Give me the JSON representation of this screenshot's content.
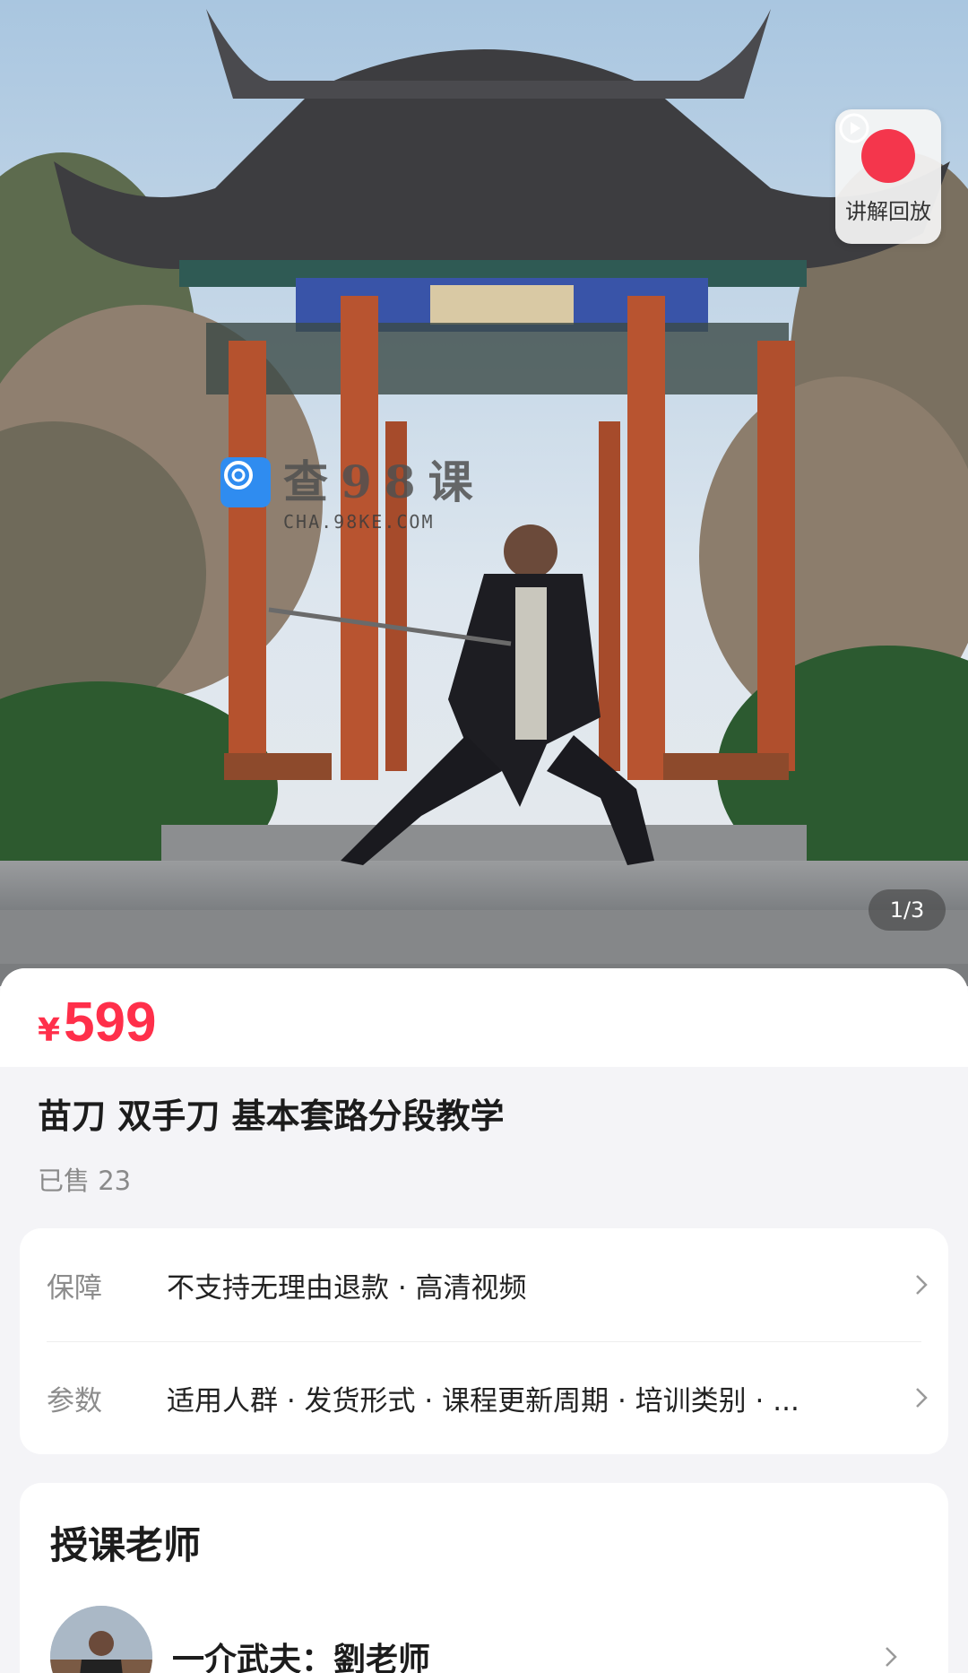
{
  "replay": {
    "label": "讲解回放",
    "icon": "play-circle-icon"
  },
  "watermark": {
    "title": "查98课",
    "subtitle": "CHA.98KE.COM"
  },
  "gallery": {
    "pager": "1/3"
  },
  "product": {
    "currency": "¥",
    "price": "599",
    "title": "苗刀 双手刀 基本套路分段教学",
    "sold": "已售 23"
  },
  "service": {
    "rows": [
      {
        "key": "保障",
        "value": "不支持无理由退款 · 高清视频"
      },
      {
        "key": "参数",
        "value": "适用人群 · 发货形式 · 课程更新周期 · 培训类别 · ..."
      }
    ]
  },
  "teacher": {
    "heading": "授课老师",
    "name": "一介武夫：劉老师"
  },
  "colors": {
    "accent": "#ff2f4a",
    "replay": "#f4364c",
    "background": "#f4f4f7"
  }
}
